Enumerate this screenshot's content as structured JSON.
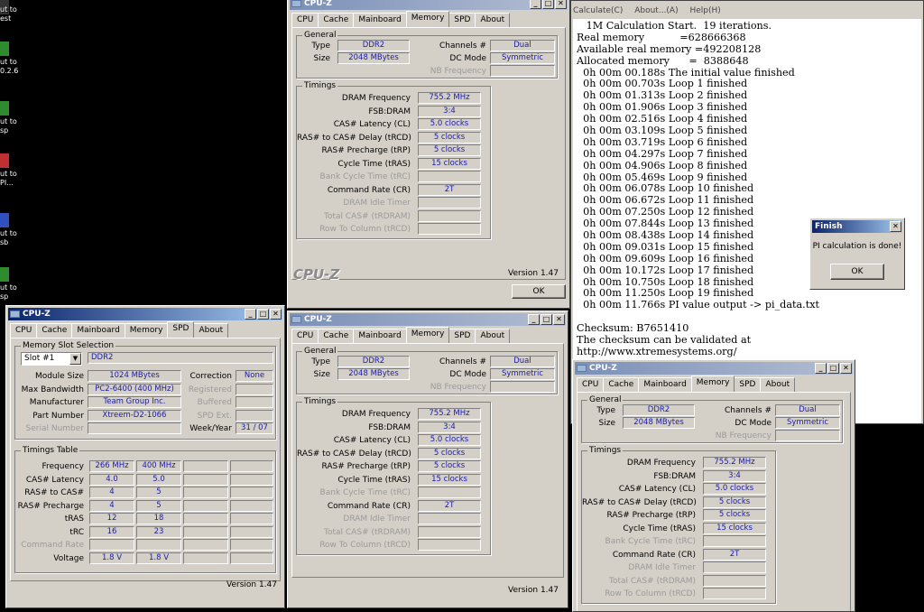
{
  "desktop": {
    "icons": [
      {
        "label": "ut to\nest",
        "icon": "shortcut-icon",
        "color": "#222"
      },
      {
        "label": "ut to\n0.2.6",
        "icon": "green-app-icon",
        "color": "#2e8b2e"
      },
      {
        "label": "ut to\nsp",
        "icon": "green-app-icon",
        "color": "#2e8b2e"
      },
      {
        "label": "ut to\nPI...",
        "icon": "pi-app-icon",
        "color": "#c03030"
      },
      {
        "label": "ut to\nsb",
        "icon": "cpu-app-icon",
        "color": "#3050c0"
      },
      {
        "label": "ut to\nsp",
        "icon": "green-app-icon",
        "color": "#2e8b2e"
      }
    ]
  },
  "cpuz_common": {
    "title": "CPU-Z",
    "tabs": [
      "CPU",
      "Cache",
      "Mainboard",
      "Memory",
      "SPD",
      "About"
    ],
    "logo": "CPU-Z",
    "version": "Version 1.47",
    "ok_label": "OK"
  },
  "memory": {
    "general_title": "General",
    "type_label": "Type",
    "type": "DDR2",
    "size_label": "Size",
    "size": "2048 MBytes",
    "channels_label": "Channels #",
    "channels": "Dual",
    "dcmode_label": "DC Mode",
    "dcmode": "Symmetric",
    "nbfreq_label": "NB Frequency",
    "timings_title": "Timings",
    "rows": [
      {
        "label": "DRAM Frequency",
        "value": "755.2 MHz",
        "disabled": false
      },
      {
        "label": "FSB:DRAM",
        "value": "3:4",
        "disabled": false
      },
      {
        "label": "CAS# Latency (CL)",
        "value": "5.0 clocks",
        "disabled": false
      },
      {
        "label": "RAS# to CAS# Delay (tRCD)",
        "value": "5 clocks",
        "disabled": false
      },
      {
        "label": "RAS# Precharge (tRP)",
        "value": "5 clocks",
        "disabled": false
      },
      {
        "label": "Cycle Time (tRAS)",
        "value": "15 clocks",
        "disabled": false
      },
      {
        "label": "Bank Cycle Time (tRC)",
        "value": "",
        "disabled": true
      },
      {
        "label": "Command Rate (CR)",
        "value": "2T",
        "disabled": false
      },
      {
        "label": "DRAM Idle Timer",
        "value": "",
        "disabled": true
      },
      {
        "label": "Total CAS# (tRDRAM)",
        "value": "",
        "disabled": true
      },
      {
        "label": "Row To Column (tRCD)",
        "value": "",
        "disabled": true
      }
    ]
  },
  "spd": {
    "slot_title": "Memory Slot Selection",
    "slot": "Slot #1",
    "slot_type": "DDR2",
    "module_size_label": "Module Size",
    "module_size": "1024 MBytes",
    "max_bw_label": "Max Bandwidth",
    "max_bw": "PC2-6400 (400 MHz)",
    "manufacturer_label": "Manufacturer",
    "manufacturer": "Team Group Inc.",
    "part_label": "Part Number",
    "part": "Xtreem-D2-1066",
    "serial_label": "Serial Number",
    "correction_label": "Correction",
    "correction": "None",
    "registered_label": "Registered",
    "buffered_label": "Buffered",
    "spdext_label": "SPD Ext.",
    "week_label": "Week/Year",
    "week": "31 / 07",
    "table_title": "Timings Table",
    "table_rows": [
      {
        "label": "Frequency",
        "v1": "266 MHz",
        "v2": "400 MHz",
        "disabled": false
      },
      {
        "label": "CAS# Latency",
        "v1": "4.0",
        "v2": "5.0",
        "disabled": false
      },
      {
        "label": "RAS# to CAS#",
        "v1": "4",
        "v2": "5",
        "disabled": false
      },
      {
        "label": "RAS# Precharge",
        "v1": "4",
        "v2": "5",
        "disabled": false
      },
      {
        "label": "tRAS",
        "v1": "12",
        "v2": "18",
        "disabled": false
      },
      {
        "label": "tRC",
        "v1": "16",
        "v2": "23",
        "disabled": false
      },
      {
        "label": "Command Rate",
        "v1": "",
        "v2": "",
        "disabled": true
      },
      {
        "label": "Voltage",
        "v1": "1.8 V",
        "v2": "1.8 V",
        "disabled": false
      }
    ]
  },
  "superpi": {
    "menu": [
      "Calculate(C)",
      "About...(A)",
      "Help(H)"
    ],
    "console_lines": [
      "   1M Calculation Start.  19 iterations.",
      "Real memory           =628666368",
      "Available real memory =492208128",
      "Allocated memory      =  8388648",
      "  0h 00m 00.188s The initial value finished",
      "  0h 00m 00.703s Loop 1 finished",
      "  0h 00m 01.313s Loop 2 finished",
      "  0h 00m 01.906s Loop 3 finished",
      "  0h 00m 02.516s Loop 4 finished",
      "  0h 00m 03.109s Loop 5 finished",
      "  0h 00m 03.719s Loop 6 finished",
      "  0h 00m 04.297s Loop 7 finished",
      "  0h 00m 04.906s Loop 8 finished",
      "  0h 00m 05.469s Loop 9 finished",
      "  0h 00m 06.078s Loop 10 finished",
      "  0h 00m 06.672s Loop 11 finished",
      "  0h 00m 07.250s Loop 12 finished",
      "  0h 00m 07.844s Loop 13 finished",
      "  0h 00m 08.438s Loop 14 finished",
      "  0h 00m 09.031s Loop 15 finished",
      "  0h 00m 09.609s Loop 16 finished",
      "  0h 00m 10.172s Loop 17 finished",
      "  0h 00m 10.750s Loop 18 finished",
      "  0h 00m 11.250s Loop 19 finished",
      "  0h 00m 11.766s PI value output -> pi_data.txt",
      "",
      "Checksum: B7651410",
      "The checksum can be validated at",
      "http://www.xtremesystems.org/"
    ]
  },
  "finish_dialog": {
    "title": "Finish",
    "message": "PI calculation is done!",
    "ok_label": "OK"
  }
}
